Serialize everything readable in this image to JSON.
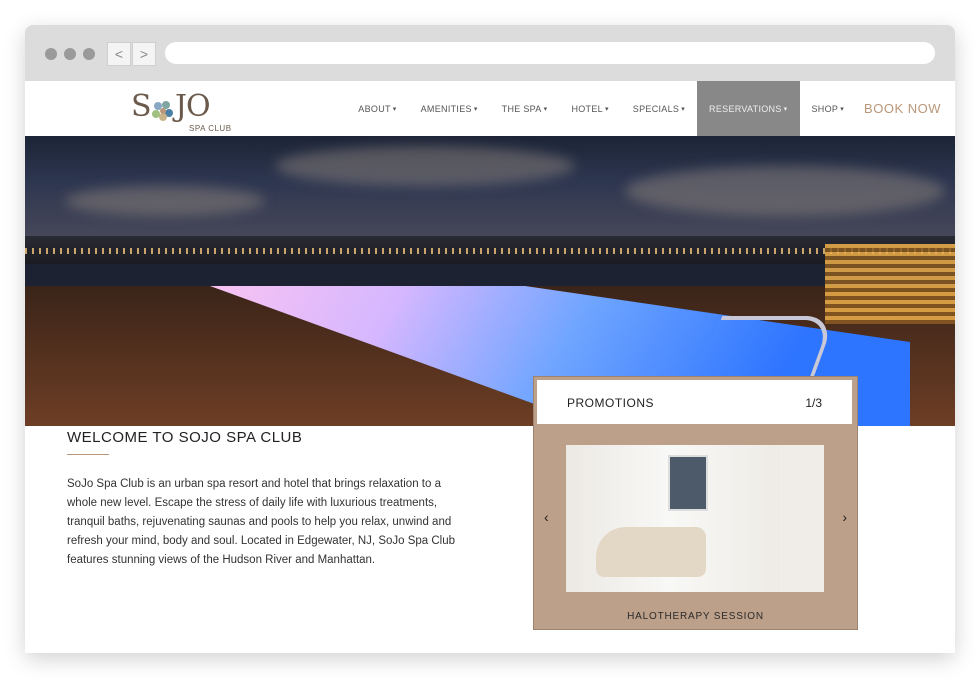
{
  "browser": {
    "back_icon": "chevron-left-icon",
    "forward_icon": "chevron-right-icon",
    "back_glyph": "<",
    "forward_glyph": ">"
  },
  "logo": {
    "s": "S",
    "jo": "JO",
    "sub": "SPA CLUB"
  },
  "menu": [
    {
      "label": "ABOUT",
      "active": false
    },
    {
      "label": "AMENITIES",
      "active": false
    },
    {
      "label": "THE SPA",
      "active": false
    },
    {
      "label": "HOTEL",
      "active": false
    },
    {
      "label": "SPECIALS",
      "active": false
    },
    {
      "label": "RESERVATIONS",
      "active": true
    },
    {
      "label": "SHOP",
      "active": false
    }
  ],
  "menu_caret": "▾",
  "book_now": "BOOK NOW",
  "welcome": {
    "title": "WELCOME TO SOJO SPA CLUB",
    "body": "SoJo Spa Club is an urban spa resort and hotel that brings relaxation to a whole new level. Escape the stress of daily life with luxurious treatments, tranquil baths, rejuvenating saunas and pools to help you relax, unwind and refresh your mind, body and soul. Located in Edgewater, NJ, SoJo Spa Club features stunning views of the Hudson River and Manhattan."
  },
  "promotions": {
    "title": "PROMOTIONS",
    "counter": "1/3",
    "prev_glyph": "‹",
    "next_glyph": "›",
    "caption": "HALOTHERAPY SESSION"
  },
  "colors": {
    "accent": "#b9977a",
    "active_menu": "#888888",
    "promo_bg": "#bca08a"
  }
}
